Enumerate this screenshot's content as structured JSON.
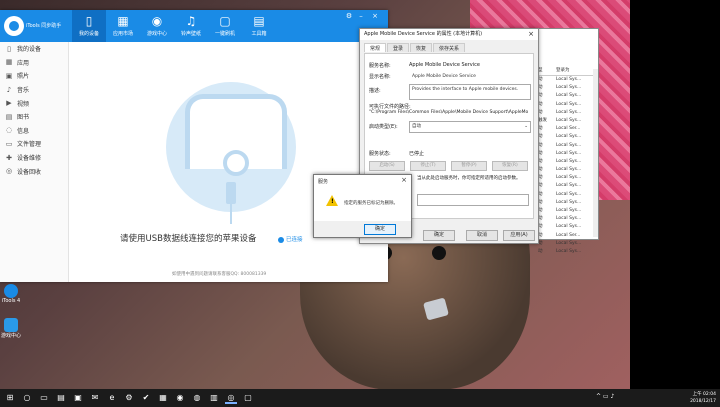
{
  "itools": {
    "brand": "iTools 同步助手",
    "nav": [
      {
        "label": "我的设备",
        "icon": "phone-icon"
      },
      {
        "label": "应用市场",
        "icon": "appstore-icon"
      },
      {
        "label": "游戏中心",
        "icon": "gamepad-icon"
      },
      {
        "label": "铃声壁纸",
        "icon": "bell-icon"
      },
      {
        "label": "一键刷机",
        "icon": "flash-icon"
      },
      {
        "label": "工具箱",
        "icon": "toolbox-icon"
      }
    ],
    "sidebar": [
      {
        "label": "我的设备",
        "icon": "device-icon"
      },
      {
        "label": "应用",
        "icon": "apps-icon"
      },
      {
        "label": "照片",
        "icon": "photo-icon"
      },
      {
        "label": "音乐",
        "icon": "music-icon"
      },
      {
        "label": "视频",
        "icon": "video-icon"
      },
      {
        "label": "图书",
        "icon": "book-icon"
      },
      {
        "label": "信息",
        "icon": "message-icon"
      },
      {
        "label": "文件管理",
        "icon": "folder-icon"
      },
      {
        "label": "设备维修",
        "icon": "repair-icon"
      },
      {
        "label": "设备回收",
        "icon": "recycle-icon"
      }
    ],
    "connect_prompt": "请使用USB数据线连接您的苹果设备",
    "connected_hint": "已连接",
    "contact_line": "如使用中遇到问题请联系客服QQ: 800081339"
  },
  "properties": {
    "title": "Apple Mobile Device Service 的属性 (本地计算机)",
    "tabs": [
      "常规",
      "登录",
      "恢复",
      "依存关系"
    ],
    "service_name_label": "服务名称:",
    "service_name": "Apple Mobile Device Service",
    "display_name_label": "显示名称:",
    "display_name": "Apple Mobile Device Service",
    "description_label": "描述:",
    "description": "Provides the interface to Apple mobile devices.",
    "path_label": "可执行文件的路径:",
    "path": "\"C:\\Program Files\\Common Files\\Apple\\Mobile Device Support\\AppleMo",
    "startup_label": "启动类型(E):",
    "startup_value": "自动",
    "status_label": "服务状态:",
    "status_value": "已停止",
    "buttons": [
      "启动(S)",
      "停止(T)",
      "暂停(P)",
      "恢复(R)"
    ],
    "params_hint": "当从此处启动服务时，你可指定所适用的启动参数。",
    "ok": "确定",
    "cancel": "取消",
    "apply": "应用(A)"
  },
  "services": {
    "headers": [
      "型",
      "登录为"
    ],
    "rows": [
      [
        "动",
        "Local Sys..."
      ],
      [
        "动",
        "Local Sys..."
      ],
      [
        "动",
        "Local Sys..."
      ],
      [
        "动",
        "Local Sys..."
      ],
      [
        "动",
        "Local Sys..."
      ],
      [
        "触发",
        "Local Sys..."
      ],
      [
        "动",
        "Local Ser..."
      ],
      [
        "动",
        "Local Sys..."
      ],
      [
        "动",
        "Local Sys..."
      ],
      [
        "动",
        "Local Sys..."
      ],
      [
        "动",
        "Local Sys..."
      ],
      [
        "动",
        "Local Sys..."
      ],
      [
        "动",
        "Local Sys..."
      ],
      [
        "动",
        "Local Sys..."
      ],
      [
        "动",
        "Local Sys..."
      ],
      [
        "动",
        "Local Sys..."
      ],
      [
        "动",
        "Local Sys..."
      ],
      [
        "动",
        "Local Sys..."
      ],
      [
        "动",
        "Local Sys..."
      ],
      [
        "动",
        "Local Ser..."
      ],
      [
        "动",
        "Local Sys..."
      ],
      [
        "动",
        "Local Sys..."
      ]
    ]
  },
  "alert": {
    "title": "服务",
    "message": "指定的服务已标记为删除。",
    "ok": "确定"
  },
  "desktop": [
    {
      "label": "iTools 4",
      "color": "#1a8be6"
    },
    {
      "label": "游戏中心",
      "color": "#2a9ae8"
    }
  ],
  "taskbar": {
    "time": "上午 02:04",
    "date": "2018/12/17",
    "icons": [
      "windows-icon",
      "search-icon",
      "taskview-icon",
      "explorer-icon",
      "store-icon",
      "mail-icon",
      "edge-icon",
      "settings-icon",
      "check-icon",
      "photos-icon",
      "chrome-icon",
      "360-icon",
      "calc-icon",
      "itools-icon",
      "app-icon"
    ]
  }
}
